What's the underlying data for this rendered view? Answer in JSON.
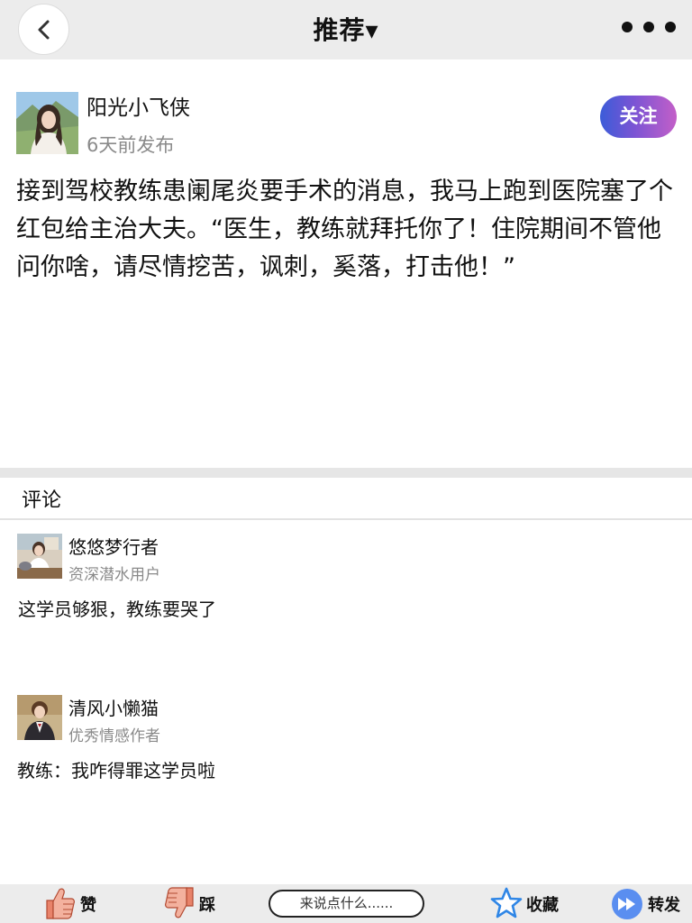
{
  "header": {
    "title": "推荐▾",
    "back_icon": "chevron-left-icon",
    "more_icon": "more-dots-icon"
  },
  "post": {
    "author": "阳光小飞侠",
    "time": "6天前发布",
    "follow_label": "关注",
    "content": "接到驾校教练患阑尾炎要手术的消息，我马上跑到医院塞了个红包给主治大夫。“医生，教练就拜托你了！住院期间不管他问你啥，请尽情挖苦，讽刺，奚落，打击他！”"
  },
  "comments": {
    "header": "评论",
    "items": [
      {
        "name": "悠悠梦行者",
        "tag": "资深潜水用户",
        "text": "这学员够狠，教练要哭了"
      },
      {
        "name": "清风小懒猫",
        "tag": "优秀情感作者",
        "text": "教练：我咋得罪这学员啦"
      }
    ]
  },
  "bottom_bar": {
    "like_label": "赞",
    "dislike_label": "踩",
    "comment_placeholder": "来说点什么......",
    "favorite_label": "收藏",
    "share_label": "转发"
  },
  "colors": {
    "header_bg": "#ececec",
    "follow_gradient_start": "#3b5cd8",
    "follow_gradient_end": "#c35fc8",
    "like_icon": "#e8836a",
    "favorite_icon": "#2f86e6",
    "share_icon": "#5a8ef0"
  }
}
